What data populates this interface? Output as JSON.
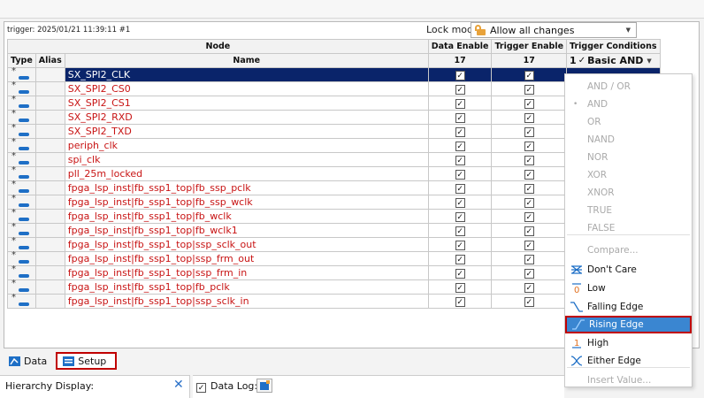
{
  "header": {
    "trigger_info": "trigger: 2025/01/21 11:39:11 #1",
    "lock_mode_label": "Lock mode:",
    "lock_mode_value": "Allow all changes"
  },
  "table": {
    "col_node": "Node",
    "col_type": "Type",
    "col_alias": "Alias",
    "col_name": "Name",
    "col_data_enable": "Data Enable",
    "col_trigger_enable": "Trigger Enable",
    "col_trigger_conditions": "Trigger Conditions",
    "data_enable_count": "17",
    "trigger_enable_count": "17",
    "tc_index": "1",
    "tc_value": "Basic AND",
    "rows": [
      {
        "name": "SX_SPI2_CLK",
        "data": "✓",
        "trig": "✓"
      },
      {
        "name": "SX_SPI2_CS0",
        "data": "✓",
        "trig": "✓"
      },
      {
        "name": "SX_SPI2_CS1",
        "data": "✓",
        "trig": "✓"
      },
      {
        "name": "SX_SPI2_RXD",
        "data": "✓",
        "trig": "✓"
      },
      {
        "name": "SX_SPI2_TXD",
        "data": "✓",
        "trig": "✓"
      },
      {
        "name": "periph_clk",
        "data": "✓",
        "trig": "✓"
      },
      {
        "name": "spi_clk",
        "data": "✓",
        "trig": "✓"
      },
      {
        "name": "pll_25m_locked",
        "data": "✓",
        "trig": "✓"
      },
      {
        "name": "fpga_lsp_inst|fb_ssp1_top|fb_ssp_pclk",
        "data": "✓",
        "trig": "✓"
      },
      {
        "name": "fpga_lsp_inst|fb_ssp1_top|fb_ssp_wclk",
        "data": "✓",
        "trig": "✓"
      },
      {
        "name": "fpga_lsp_inst|fb_ssp1_top|fb_wclk",
        "data": "✓",
        "trig": "✓"
      },
      {
        "name": "fpga_lsp_inst|fb_ssp1_top|fb_wclk1",
        "data": "✓",
        "trig": "✓"
      },
      {
        "name": "fpga_lsp_inst|fb_ssp1_top|ssp_sclk_out",
        "data": "✓",
        "trig": "✓"
      },
      {
        "name": "fpga_lsp_inst|fb_ssp1_top|ssp_frm_out",
        "data": "✓",
        "trig": "✓"
      },
      {
        "name": "fpga_lsp_inst|fb_ssp1_top|ssp_frm_in",
        "data": "✓",
        "trig": "✓"
      },
      {
        "name": "fpga_lsp_inst|fb_ssp1_top|fb_pclk",
        "data": "✓",
        "trig": "✓"
      },
      {
        "name": "fpga_lsp_inst|fb_ssp1_top|ssp_sclk_in",
        "data": "✓",
        "trig": "✓"
      }
    ],
    "type_symbol": "*"
  },
  "menu": {
    "items": [
      {
        "label": "AND / OR",
        "enabled": false
      },
      {
        "label": "AND",
        "enabled": false,
        "bullet": "•"
      },
      {
        "label": "OR",
        "enabled": false
      },
      {
        "label": "NAND",
        "enabled": false
      },
      {
        "label": "NOR",
        "enabled": false
      },
      {
        "label": "XOR",
        "enabled": false
      },
      {
        "label": "XNOR",
        "enabled": false
      },
      {
        "label": "TRUE",
        "enabled": false
      },
      {
        "label": "FALSE",
        "enabled": false
      },
      {
        "label": "Compare...",
        "enabled": false
      },
      {
        "label": "Don't Care",
        "enabled": true,
        "icon": "dont-care-icon"
      },
      {
        "label": "Low",
        "enabled": true,
        "icon": "low-icon",
        "glyph": "0"
      },
      {
        "label": "Falling Edge",
        "enabled": true,
        "icon": "falling-edge-icon"
      },
      {
        "label": "Rising Edge",
        "enabled": true,
        "icon": "rising-edge-icon",
        "highlighted": true
      },
      {
        "label": "High",
        "enabled": true,
        "icon": "high-icon",
        "glyph": "1"
      },
      {
        "label": "Either Edge",
        "enabled": true,
        "icon": "either-edge-icon"
      },
      {
        "label": "Insert Value...",
        "enabled": false
      }
    ]
  },
  "tabs": {
    "data_label": "Data",
    "setup_label": "Setup"
  },
  "bottom": {
    "hierarchy_label": "Hierarchy Display:",
    "close_glyph": "✕",
    "datalog_label": "Data Log:",
    "datalog_check": "✓"
  },
  "colors": {
    "signal_name": "#c81414",
    "selection": "#0a246a",
    "highlight": "#3a86d1",
    "callout": "#c00000",
    "accent_blue": "#1e6fc6"
  }
}
